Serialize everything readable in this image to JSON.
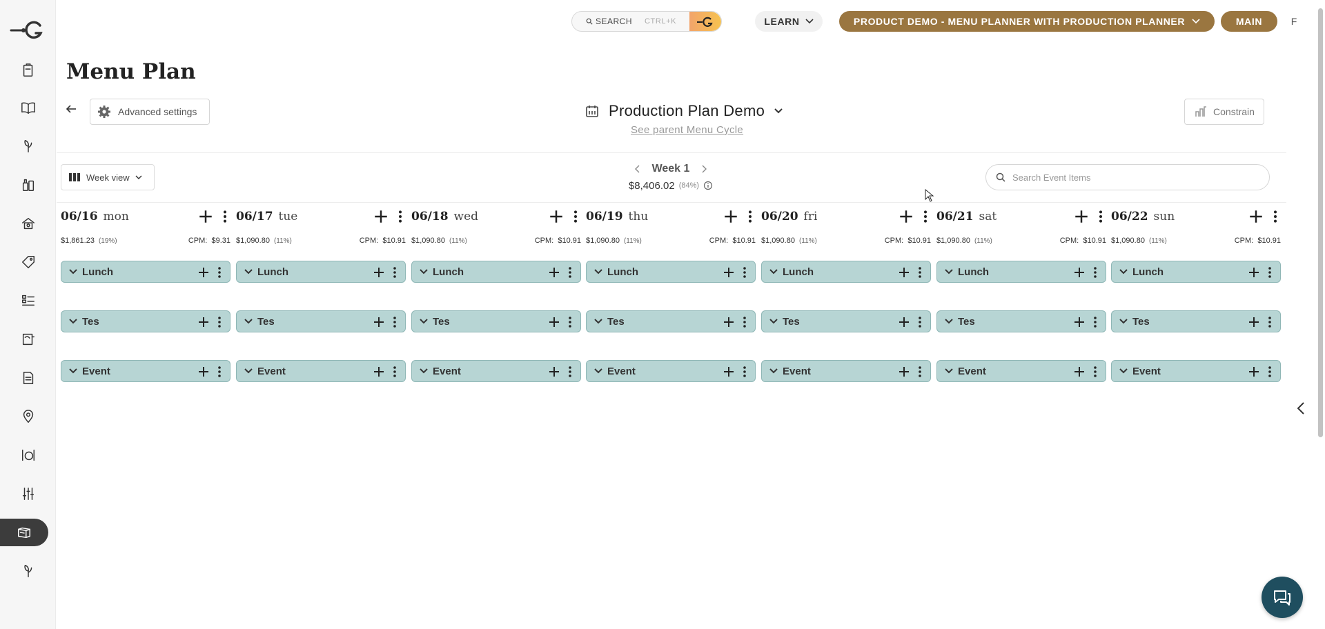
{
  "sidebar": {
    "logo": "G",
    "items": [
      {
        "icon": "clipboard-icon",
        "active": false
      },
      {
        "icon": "book-open-icon",
        "active": false
      },
      {
        "icon": "sprout-icon",
        "active": false
      },
      {
        "icon": "bottles-icon",
        "active": false
      },
      {
        "icon": "chef-station-icon",
        "active": false
      },
      {
        "icon": "price-tag-icon",
        "active": false
      },
      {
        "icon": "checklist-icon",
        "active": false
      },
      {
        "icon": "recipe-book-icon",
        "active": false
      },
      {
        "icon": "document-icon",
        "active": false
      },
      {
        "icon": "location-pin-icon",
        "active": false
      },
      {
        "icon": "dining-icon",
        "active": false
      },
      {
        "icon": "sliders-icon",
        "active": false
      },
      {
        "icon": "menu-plan-icon",
        "active": true
      },
      {
        "icon": "sprout-icon",
        "active": false
      }
    ]
  },
  "topbar": {
    "search_label": "SEARCH",
    "search_shortcut": "CTRL+K",
    "learn_label": "LEARN",
    "product_label": "PRODUCT DEMO - MENU PLANNER WITH PRODUCTION PLANNER",
    "main_label": "MAIN",
    "avatar_initial": "F",
    "accent_color": "#9a7640"
  },
  "page": {
    "title": "Menu Plan",
    "advanced_settings": "Advanced settings",
    "plan_name": "Production Plan Demo",
    "parent_link": "See parent Menu Cycle",
    "constrain_label": "Constrain"
  },
  "toolbar": {
    "view_label": "Week view",
    "week_label": "Week 1",
    "week_cost": "$8,406.02",
    "week_pct": "(84%)",
    "search_placeholder": "Search Event Items"
  },
  "days": [
    {
      "date": "06/16",
      "dow": "mon",
      "cost": "$1,861.23",
      "pct": "(19%)",
      "cpm": "CPM:",
      "cpm_value": "$9.31"
    },
    {
      "date": "06/17",
      "dow": "tue",
      "cost": "$1,090.80",
      "pct": "(11%)",
      "cpm": "CPM:",
      "cpm_value": "$10.91"
    },
    {
      "date": "06/18",
      "dow": "wed",
      "cost": "$1,090.80",
      "pct": "(11%)",
      "cpm": "CPM:",
      "cpm_value": "$10.91"
    },
    {
      "date": "06/19",
      "dow": "thu",
      "cost": "$1,090.80",
      "pct": "(11%)",
      "cpm": "CPM:",
      "cpm_value": "$10.91"
    },
    {
      "date": "06/20",
      "dow": "fri",
      "cost": "$1,090.80",
      "pct": "(11%)",
      "cpm": "CPM:",
      "cpm_value": "$10.91"
    },
    {
      "date": "06/21",
      "dow": "sat",
      "cost": "$1,090.80",
      "pct": "(11%)",
      "cpm": "CPM:",
      "cpm_value": "$10.91"
    },
    {
      "date": "06/22",
      "dow": "sun",
      "cost": "$1,090.80",
      "pct": "(11%)",
      "cpm": "CPM:",
      "cpm_value": "$10.91"
    }
  ],
  "meals": [
    "Lunch",
    "Tes",
    "Event"
  ],
  "meal_color": "#b7d5d4"
}
